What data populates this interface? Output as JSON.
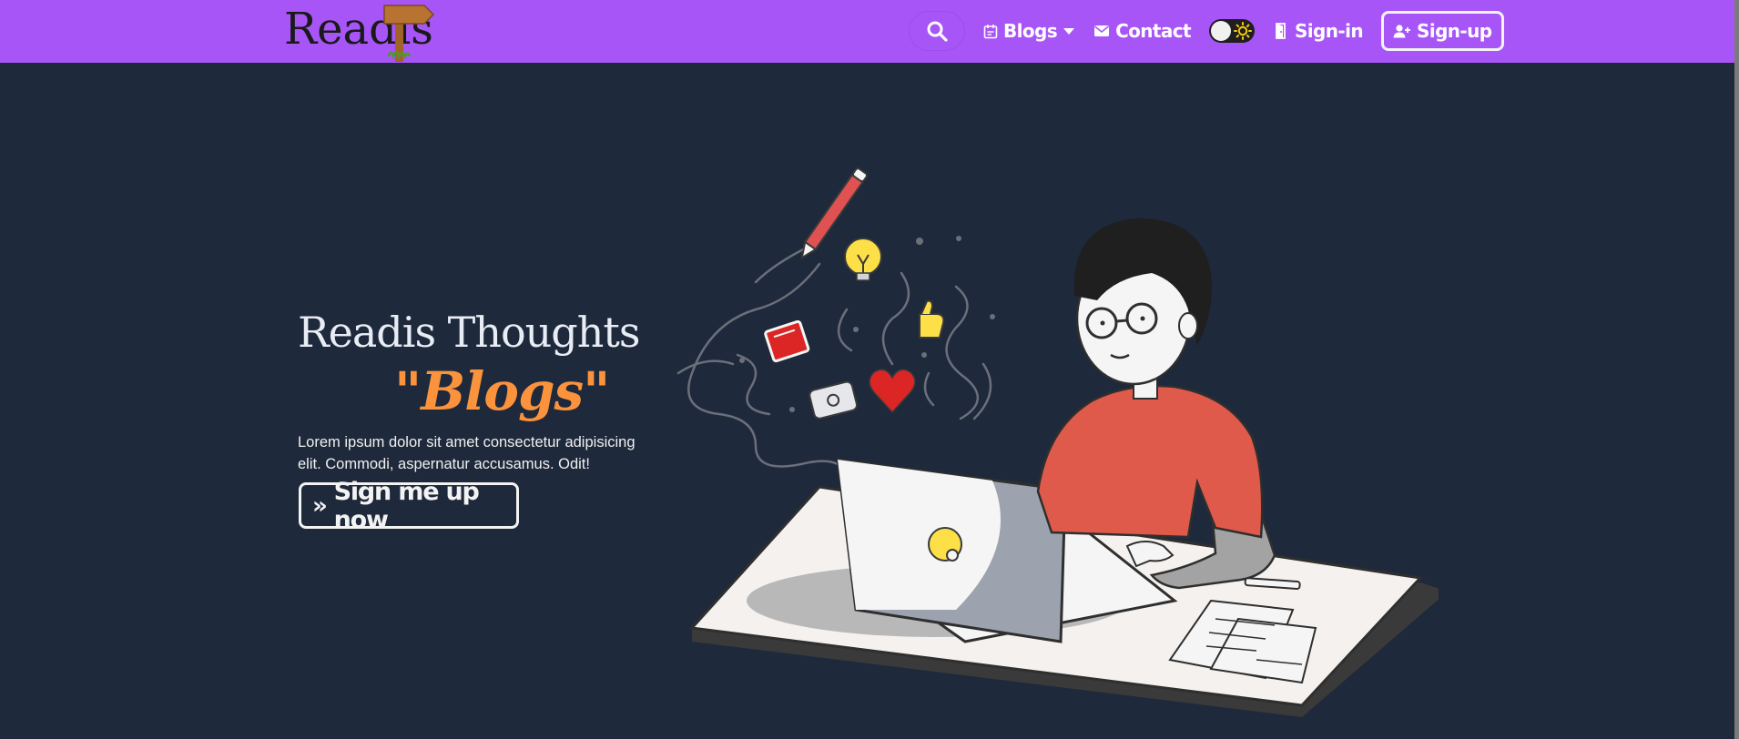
{
  "brand": {
    "name": "Readis"
  },
  "nav": {
    "blogs_label": "Blogs",
    "contact_label": "Contact",
    "signin_label": "Sign-in",
    "signup_label": "Sign-up"
  },
  "hero": {
    "title": "Readis Thoughts",
    "subtitle": "\"Blogs\"",
    "description": "Lorem ipsum dolor sit amet consectetur adipisicing elit. Commodi, aspernatur accusamus. Odit!",
    "cta_arrows": "»",
    "cta_label": "Sign me up now"
  },
  "colors": {
    "navbar": "#a855f7",
    "background": "#1e293b",
    "accent": "#fb923c"
  },
  "icons": [
    "search-icon",
    "calendar-icon",
    "chevron-down-icon",
    "mail-icon",
    "sun-icon",
    "door-icon",
    "user-plus-icon"
  ]
}
